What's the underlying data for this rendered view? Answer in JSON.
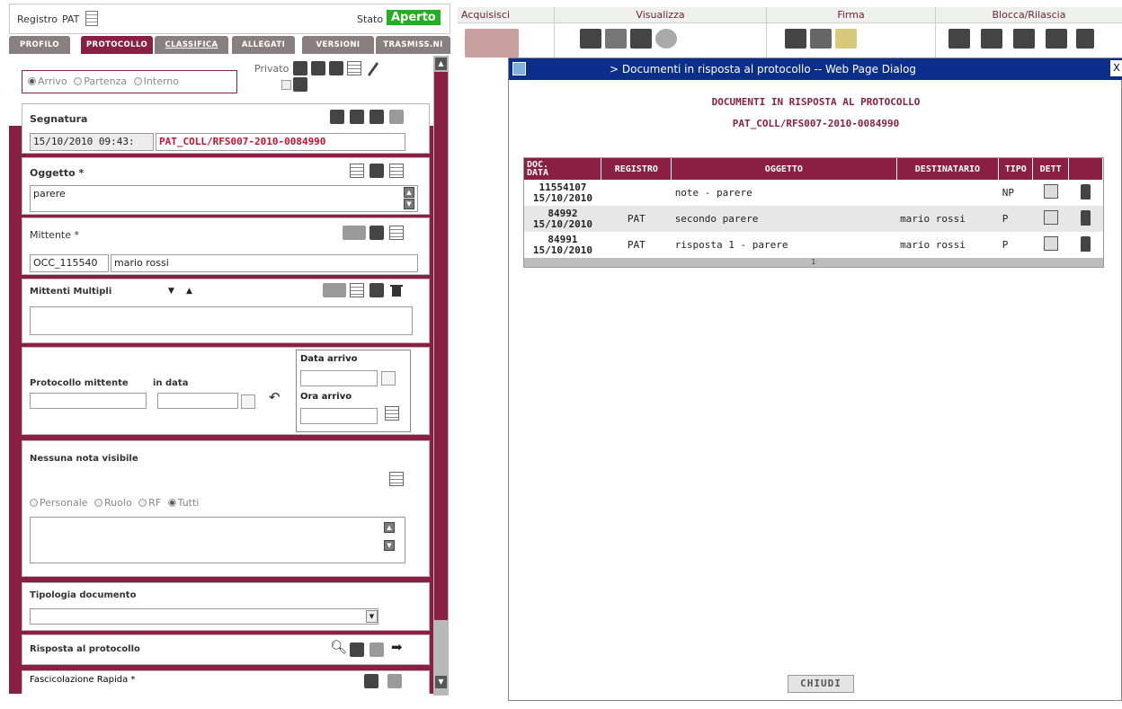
{
  "header": {
    "registro_label": "Registro",
    "registro_value": "PAT",
    "stato_label": "Stato",
    "stato_value": "Aperto"
  },
  "tabs": [
    "PROFILO",
    "PROTOCOLLO",
    "CLASSIFICA",
    "ALLEGATI",
    "VERSIONI",
    "TRASMISS.NI"
  ],
  "protocol": {
    "direction_options": [
      "Arrivo",
      "Partenza",
      "Interno"
    ],
    "direction_selected": "Arrivo",
    "privato_label": "Privato"
  },
  "segnatura": {
    "title": "Segnatura",
    "date": "15/10/2010 09:43:",
    "code": "PAT_COLL/RFS007-2010-0084990"
  },
  "oggetto": {
    "title": "Oggetto *",
    "value": "parere"
  },
  "mittente": {
    "title": "Mittente *",
    "code": "OCC_115540",
    "name": "mario rossi"
  },
  "mittenti_multipli": {
    "title": "Mittenti Multipli"
  },
  "protocollo_mittente": {
    "title": "Protocollo mittente",
    "in_data_label": "in data",
    "data_arrivo_label": "Data arrivo",
    "ora_arrivo_label": "Ora arrivo"
  },
  "note": {
    "title": "Nessuna nota visibile",
    "visibility_options": [
      "Personale",
      "Ruolo",
      "RF",
      "Tutti"
    ],
    "visibility_selected": "Tutti"
  },
  "tipologia": {
    "title": "Tipologia documento"
  },
  "risposta": {
    "title": "Risposta al protocollo"
  },
  "fascicolazione": {
    "title": "Fascicolazione Rapida *"
  },
  "toolbar": {
    "groups": [
      "Acquisisci",
      "Visualizza",
      "Firma",
      "Blocca/Rilascia"
    ]
  },
  "dialog": {
    "title": "> Documenti in risposta al protocollo -- Web Page Dialog",
    "close_glyph": "X",
    "heading": "DOCUMENTI IN RISPOSTA AL PROTOCOLLO",
    "subheading": "PAT_COLL/RFS007-2010-0084990",
    "columns": {
      "doc_top": "DOC.",
      "doc_bottom": "DATA",
      "registro": "REGISTRO",
      "oggetto": "OGGETTO",
      "destinatario": "DESTINATARIO",
      "tipo": "TIPO",
      "dett": "DETT"
    },
    "rows": [
      {
        "doc": "11554107",
        "data": "15/10/2010",
        "registro": "",
        "oggetto": "note - parere",
        "destinatario": "",
        "tipo": "NP"
      },
      {
        "doc": "84992",
        "data": "15/10/2010",
        "registro": "PAT",
        "oggetto": "secondo parere",
        "destinatario": "mario rossi",
        "tipo": "P"
      },
      {
        "doc": "84991",
        "data": "15/10/2010",
        "registro": "PAT",
        "oggetto": "risposta 1 - parere",
        "destinatario": "mario rossi",
        "tipo": "P"
      }
    ],
    "page": "1",
    "close_button": "CHIUDI"
  }
}
